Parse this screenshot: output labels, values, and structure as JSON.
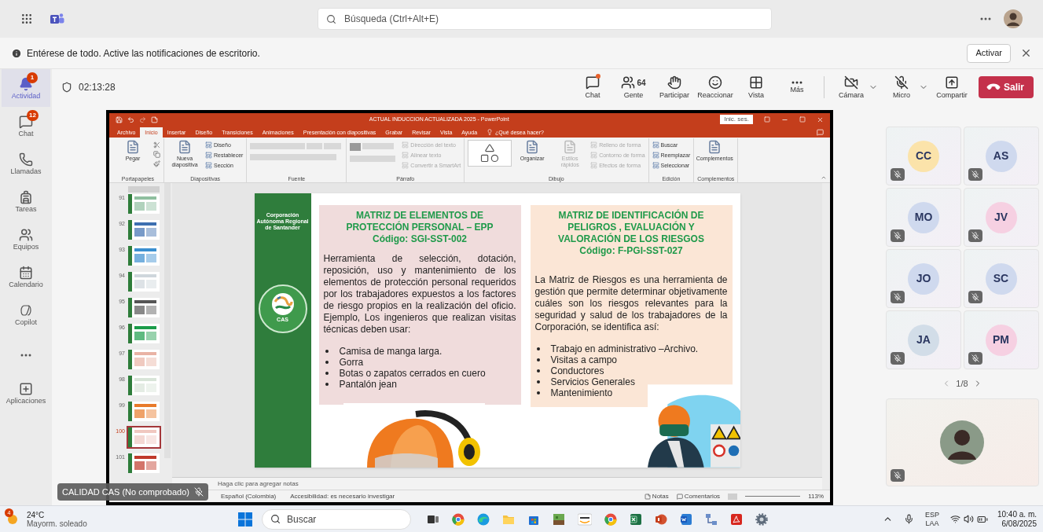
{
  "top_bar": {
    "search": {
      "placeholder": "Búsqueda (Ctrl+Alt+E)"
    }
  },
  "notification": {
    "message": "Entérese de todo. Active las notificaciones de escritorio.",
    "action": "Activar"
  },
  "rail": [
    {
      "kind": "activity",
      "label": "Actividad",
      "badge": "1",
      "selected": true
    },
    {
      "kind": "chat",
      "label": "Chat",
      "badge": "12",
      "selected": false
    },
    {
      "kind": "calls",
      "label": "Llamadas",
      "selected": false
    },
    {
      "kind": "tasks",
      "label": "Tareas",
      "selected": false
    },
    {
      "kind": "teams",
      "label": "Equipos",
      "selected": false
    },
    {
      "kind": "calendar",
      "label": "Calendario",
      "selected": false
    },
    {
      "kind": "copilot",
      "label": "Copilot",
      "selected": false
    },
    {
      "kind": "more",
      "selected": false
    },
    {
      "kind": "apps",
      "label": "Aplicaciones",
      "selected": false
    }
  ],
  "meeting": {
    "timer": "02:13:28",
    "controls": [
      {
        "kind": "chat",
        "label": "Chat",
        "unread": true
      },
      {
        "kind": "people",
        "label": "Gente",
        "count": "64"
      },
      {
        "kind": "raise_hand",
        "label": "Participar"
      },
      {
        "kind": "react",
        "label": "Reaccionar"
      },
      {
        "kind": "view",
        "label": "Vista"
      },
      {
        "kind": "more",
        "label": "Más"
      },
      {
        "kind": "camera",
        "label": "Cámara",
        "off": true
      },
      {
        "kind": "mic",
        "label": "Micro",
        "off": true
      },
      {
        "kind": "share",
        "label": "Compartir"
      }
    ],
    "leave": "Salir"
  },
  "presenter": {
    "name": "CALIDAD CAS (No comprobado)",
    "muted": true
  },
  "powerpoint": {
    "title": "ACTUAL INDUCCION ACTUALIZADA 2025 - PowerPoint",
    "sign_in": "Inic. ses.",
    "tabs": [
      {
        "label": "Archivo",
        "selected": false
      },
      {
        "label": "Inicio",
        "selected": true
      },
      {
        "label": "Insertar",
        "selected": false
      },
      {
        "label": "Diseño",
        "selected": false
      },
      {
        "label": "Transiciones",
        "selected": false
      },
      {
        "label": "Animaciones",
        "selected": false
      },
      {
        "label": "Presentación con diapositivas",
        "selected": false
      },
      {
        "label": "Grabar",
        "selected": false
      },
      {
        "label": "Revisar",
        "selected": false
      },
      {
        "label": "Vista",
        "selected": false
      },
      {
        "label": "Ayuda",
        "selected": false
      }
    ],
    "tell_me": "¿Qué desea hacer?",
    "ribbon": [
      {
        "kind": "clipboard",
        "label": "Portapapeles",
        "items": [
          {
            "kind": "large",
            "label": "Pegar",
            "disabled": false
          }
        ]
      },
      {
        "kind": "slides",
        "label": "Diapositivas",
        "items": [
          {
            "kind": "large",
            "label": "Nueva diapositiva",
            "disabled": false
          },
          {
            "kind": "small",
            "label": "Diseño",
            "disabled": false
          },
          {
            "kind": "small",
            "label": "Restablecer",
            "disabled": false
          },
          {
            "kind": "small",
            "label": "Sección",
            "disabled": false
          }
        ]
      },
      {
        "kind": "font",
        "label": "Fuente"
      },
      {
        "kind": "paragraph",
        "label": "Párrafo",
        "items": [
          {
            "kind": "small",
            "label": "Dirección del texto",
            "disabled": true
          },
          {
            "kind": "small",
            "label": "Alinear texto",
            "disabled": true
          },
          {
            "kind": "small",
            "label": "Convertir a SmartArt",
            "disabled": true
          }
        ]
      },
      {
        "kind": "drawing",
        "label": "Dibujo",
        "items": [
          {
            "kind": "large",
            "label": "Organizar",
            "disabled": false
          },
          {
            "kind": "large",
            "label": "Estilos rápidos",
            "disabled": true
          },
          {
            "kind": "small",
            "label": "Relleno de forma",
            "disabled": true
          },
          {
            "kind": "small",
            "label": "Contorno de forma",
            "disabled": true
          },
          {
            "kind": "small",
            "label": "Efectos de forma",
            "disabled": true
          }
        ]
      },
      {
        "kind": "editing",
        "label": "Edición",
        "items": [
          {
            "kind": "small",
            "label": "Buscar",
            "disabled": false
          },
          {
            "kind": "small",
            "label": "Reemplazar",
            "disabled": false
          },
          {
            "kind": "small",
            "label": "Seleccionar",
            "disabled": false
          }
        ]
      },
      {
        "kind": "addins",
        "label": "Complementos",
        "items": [
          {
            "kind": "large",
            "label": "Complementos",
            "disabled": false
          }
        ]
      }
    ],
    "thumbnails": [
      {
        "number": "91",
        "selected": false
      },
      {
        "number": "92",
        "selected": false
      },
      {
        "number": "93",
        "selected": false
      },
      {
        "number": "94",
        "selected": false
      },
      {
        "number": "95",
        "selected": false
      },
      {
        "number": "96",
        "selected": false
      },
      {
        "number": "97",
        "selected": false
      },
      {
        "number": "98",
        "selected": false
      },
      {
        "number": "99",
        "selected": false
      },
      {
        "number": "100",
        "selected": true
      },
      {
        "number": "101",
        "selected": false
      }
    ],
    "slide": {
      "organization": "Corporación Autónoma Regional de Santander",
      "logo_text": "CAS",
      "panels": [
        {
          "title": "MATRIZ DE ELEMENTOS DE PROTECCIÓN PERSONAL – EPP",
          "code": "Código: SGI-SST-002",
          "color": "#f0dcdc",
          "body": "Herramienta de selección, dotación, reposición, uso y mantenimiento de los elementos de protección personal requeridos por los trabajadores expuestos a los factores de riesgo propios en la realización del oficio. Ejemplo, Los ingenieros que realizan visitas técnicas deben usar:",
          "bullets": [
            "Camisa de manga larga.",
            "Gorra",
            "Botas o zapatos cerrados en cuero",
            "Pantalón jean"
          ]
        },
        {
          "title": "MATRIZ DE IDENTIFICACIÓN DE PELIGROS , EVALUACIÓN Y VALORACIÓN DE LOS RIESGOS",
          "code": "Código: F-PGI-SST-027",
          "color": "#fbe6d6",
          "body": "La Matriz de Riesgos es una herramienta de gestión que permite determinar objetivamente cuáles son los riesgos relevantes para la seguridad y salud de los trabajadores de la Corporación, se identifica así:",
          "bullets": [
            "Trabajo en administrativo –Archivo.",
            "Visitas a campo",
            "Conductores",
            "Servicios Generales",
            "Mantenimiento"
          ]
        }
      ]
    },
    "notes_placeholder": "Haga clic para agregar notas",
    "status": {
      "language": "Español (Colombia)",
      "accessibility": "Accesibilidad: es necesario investigar",
      "notes": "Notas",
      "comments": "Comentarios",
      "zoom": "113%"
    }
  },
  "participants": [
    {
      "initials": "CC",
      "color": "#fbe3aa",
      "muted": true
    },
    {
      "initials": "AS",
      "color": "#cfd9ee",
      "muted": true
    },
    {
      "initials": "MO",
      "color": "#cfd9ee",
      "muted": true
    },
    {
      "initials": "JV",
      "color": "#f6d0e2",
      "muted": true
    },
    {
      "initials": "JO",
      "color": "#cfd9ee",
      "muted": true
    },
    {
      "initials": "SC",
      "color": "#cfd9ee",
      "muted": true
    },
    {
      "initials": "JA",
      "color": "#d2dde8",
      "muted": true
    },
    {
      "initials": "PM",
      "color": "#f6d0e2",
      "muted": true
    }
  ],
  "pager": "1/8",
  "self_view": {
    "muted": true
  },
  "taskbar": {
    "weather": {
      "temperature": "24°C",
      "condition": "Mayorm. soleado",
      "badge": "4"
    },
    "search": {
      "placeholder": "Buscar"
    },
    "apps": [
      {
        "kind": "taskview"
      },
      {
        "kind": "chrome"
      },
      {
        "kind": "edge"
      },
      {
        "kind": "explorer"
      },
      {
        "kind": "store"
      },
      {
        "kind": "game"
      },
      {
        "kind": "amazon"
      },
      {
        "kind": "chrome"
      },
      {
        "kind": "excel"
      },
      {
        "kind": "powerpoint"
      },
      {
        "kind": "word"
      },
      {
        "kind": "diagram"
      },
      {
        "kind": "acrobat"
      },
      {
        "kind": "settings"
      }
    ],
    "tray": {
      "language": "ESP",
      "layout": "LAA",
      "time": "10:40 a. m.",
      "date": "6/08/2025"
    }
  }
}
